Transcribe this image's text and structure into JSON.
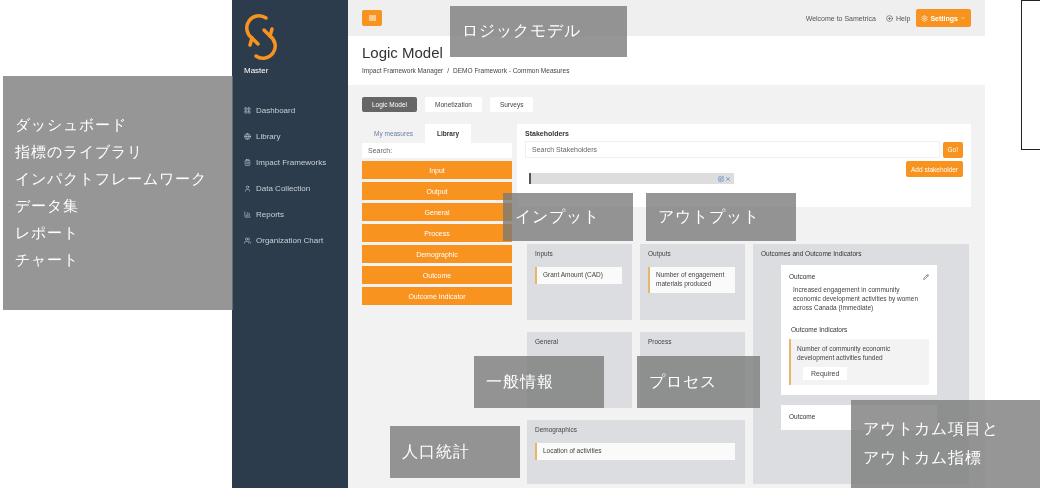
{
  "annotations": [
    {
      "kind": "title",
      "lines": [
        "ロジックモデル"
      ]
    },
    {
      "kind": "menu",
      "lines": [
        "ダッシュボード",
        "指標のライブラリ",
        "インパクトフレームワーク",
        "データ集",
        "レポート",
        "チャート"
      ]
    },
    {
      "kind": "input",
      "lines": [
        "インプット"
      ]
    },
    {
      "kind": "output",
      "lines": [
        "アウトプット"
      ]
    },
    {
      "kind": "general",
      "lines": [
        "一般情報"
      ]
    },
    {
      "kind": "process",
      "lines": [
        "プロセス"
      ]
    },
    {
      "kind": "demographic",
      "lines": [
        "人口統計"
      ]
    },
    {
      "kind": "outcome",
      "lines": [
        "アウトカム項目と",
        "アウトカム指標"
      ]
    }
  ],
  "sidebar": {
    "brand": "Master",
    "items": [
      {
        "kind": "grid",
        "label": "Dashboard"
      },
      {
        "kind": "globe",
        "label": "Library"
      },
      {
        "kind": "clipboard",
        "label": "Impact Frameworks"
      },
      {
        "kind": "user",
        "label": "Data Collection"
      },
      {
        "kind": "chart",
        "label": "Reports"
      },
      {
        "kind": "users",
        "label": "Organization Chart"
      }
    ]
  },
  "topbar": {
    "welcome": "Welcome to Sametrica",
    "help": "Help",
    "settings": "Settings"
  },
  "header": {
    "title": "Logic Model",
    "breadcrumb": {
      "items": [
        "Impact Framework Manager",
        "DEMO Framework - Common Measures"
      ],
      "separator": "/"
    }
  },
  "tabs": [
    {
      "label": "Logic Model",
      "selected": true
    },
    {
      "label": "Monetization",
      "selected": false
    },
    {
      "label": "Surveys",
      "selected": false
    }
  ],
  "measure_tabs": [
    {
      "label": "My measures",
      "selected": false
    },
    {
      "label": "Library",
      "selected": true
    }
  ],
  "search": {
    "placeholder": "Search:"
  },
  "categories": [
    "Input",
    "Output",
    "General",
    "Process",
    "Demographic",
    "Outcome",
    "Outcome Indicator"
  ],
  "stakeholders": {
    "title": "Stakeholders",
    "placeholder": "Search Stakeholders",
    "go": "Go!",
    "add": "Add stakeholder"
  },
  "boxes": [
    {
      "kind": "input",
      "title": "Inputs",
      "items": [
        "Grant Amount (CAD)"
      ]
    },
    {
      "kind": "output",
      "title": "Outputs",
      "items": [
        "Number of engagement materials produced"
      ]
    },
    {
      "kind": "general",
      "title": "General"
    },
    {
      "kind": "process",
      "title": "Process"
    },
    {
      "kind": "demographic",
      "title": "Demographics",
      "items": [
        "Location of activities"
      ]
    }
  ],
  "outcomes": {
    "title": "Outcomes and Outcome Indicators",
    "cards": [
      {
        "heading": "Outcome",
        "text": "Increased engagement in community economic development activities by women across Canada (Immediate)",
        "indicators_title": "Outcome Indicators",
        "indicators": [
          {
            "text": "Number of community economic development activities funded",
            "badge": "Required"
          }
        ]
      },
      {
        "heading": "Outcome"
      }
    ]
  }
}
